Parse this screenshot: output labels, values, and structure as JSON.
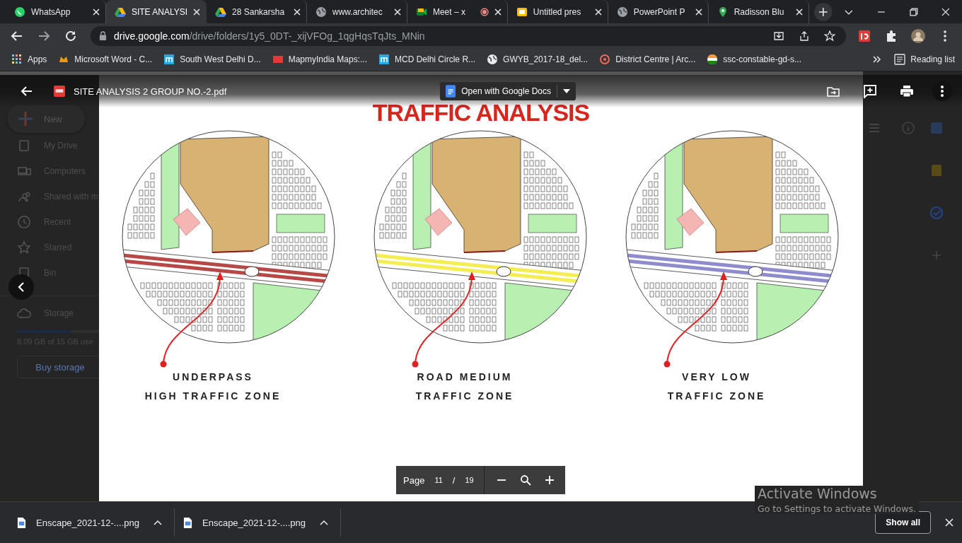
{
  "tabs": [
    {
      "title": "WhatsApp",
      "kind": "whatsapp",
      "selected": false
    },
    {
      "title": "SITE ANALYSI",
      "kind": "drive",
      "selected": true
    },
    {
      "title": "28 Sankarsha",
      "kind": "drive",
      "selected": false
    },
    {
      "title": "www.architec",
      "kind": "globe",
      "selected": false
    },
    {
      "title": "Meet – x",
      "kind": "meet",
      "selected": false
    },
    {
      "title": "Untitled pres",
      "kind": "slides",
      "selected": false
    },
    {
      "title": "PowerPoint P",
      "kind": "globe",
      "selected": false
    },
    {
      "title": "Radisson Blu",
      "kind": "maps",
      "selected": false
    }
  ],
  "address": {
    "domain": "drive.google.com",
    "path": "/drive/folders/1y5_0DT-_xijVFOg_1qgHqsTqJts_MNin"
  },
  "bookmarks": [
    {
      "label": "Apps",
      "kind": "apps"
    },
    {
      "label": "Microsoft Word - C...",
      "kind": "orange"
    },
    {
      "label": "South West Delhi D...",
      "kind": "m"
    },
    {
      "label": "MapmyIndia Maps:...",
      "kind": "red"
    },
    {
      "label": "MCD Delhi Circle R...",
      "kind": "m"
    },
    {
      "label": "GWYB_2017-18_del...",
      "kind": "globe"
    },
    {
      "label": "District Centre | Arc...",
      "kind": "target"
    },
    {
      "label": "ssc-constable-gd-s...",
      "kind": "flag"
    }
  ],
  "reading_list": "Reading list",
  "drive": {
    "new_button": "New",
    "nav": [
      {
        "label": "My Drive",
        "kind": "drive"
      },
      {
        "label": "Computers",
        "kind": "computer"
      },
      {
        "label": "Shared with m",
        "kind": "shared"
      },
      {
        "label": "Recent",
        "kind": "recent"
      },
      {
        "label": "Starred",
        "kind": "star"
      },
      {
        "label": "Bin",
        "kind": "bin"
      }
    ],
    "storage": {
      "label": "Storage",
      "level": 0.54,
      "usage": "8.09 GB of 15 GB use",
      "button": "Buy storage"
    }
  },
  "viewer": {
    "file_name": "SITE ANALYSIS 2 GROUP NO.-2.pdf",
    "open_with": "Open with Google Docs"
  },
  "pdf": {
    "title": "TRAFFIC ANALYSIS",
    "maps": [
      {
        "label_top": "UNDERPASS",
        "label_bottom": "HIGH TRAFFIC ZONE",
        "color": "#b84848"
      },
      {
        "label_top": "ROAD MEDIUM",
        "label_bottom": "TRAFFIC ZONE",
        "color": "#f3ec52"
      },
      {
        "label_top": "VERY LOW",
        "label_bottom": "TRAFFIC ZONE",
        "color": "#8e8ccc"
      }
    ]
  },
  "page_controls": {
    "label": "Page",
    "current": "11",
    "separator": "/",
    "total": "19"
  },
  "downloads": [
    {
      "file": "Enscape_2021-12-....png"
    },
    {
      "file": "Enscape_2021-12-....png"
    }
  ],
  "show_all": "Show all",
  "windows_notice": {
    "title": "Activate Windows",
    "text": "Go to Settings to activate Windows."
  }
}
